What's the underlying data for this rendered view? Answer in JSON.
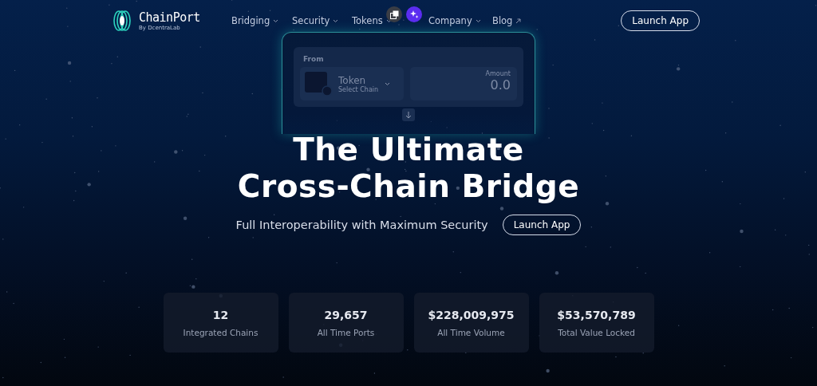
{
  "logo": {
    "name": "ChainPort",
    "tagline": "By DcentraLab"
  },
  "nav": [
    {
      "label": "Bridging",
      "kind": "menu"
    },
    {
      "label": "Security",
      "kind": "menu"
    },
    {
      "label": "Tokens",
      "kind": "menu"
    },
    {
      "label": "Company",
      "kind": "menu"
    },
    {
      "label": "Blog",
      "kind": "external"
    }
  ],
  "header_button": "Launch App",
  "swap_card": {
    "from_label": "From",
    "token": "Token",
    "chain": "Select Chain",
    "amount_label": "Amount",
    "amount": "0.0"
  },
  "hero": {
    "title_lines": [
      "The Ultimate",
      "Cross-Chain Bridge"
    ],
    "subtitle": "Full Interoperability with Maximum Security",
    "button": "Launch App"
  },
  "stats": [
    {
      "value": "12",
      "label": "Integrated Chains"
    },
    {
      "value": "29,657",
      "label": "All Time Ports"
    },
    {
      "value": "$228,009,975",
      "label": "All Time Volume"
    },
    {
      "value": "$53,570,789",
      "label": "Total Value Locked"
    }
  ]
}
